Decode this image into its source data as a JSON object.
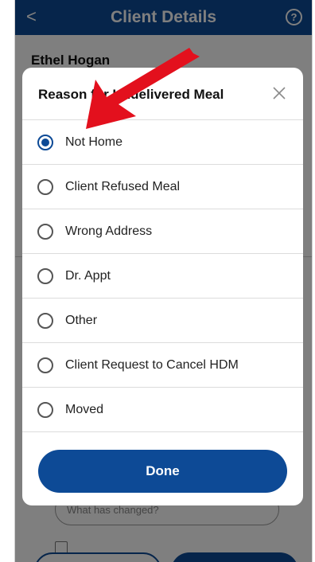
{
  "header": {
    "title": "Client Details",
    "back_glyph": "<",
    "help_glyph": "?"
  },
  "client": {
    "name": "Ethel Hogan"
  },
  "background_form": {
    "changes_placeholder": "What has changed?"
  },
  "modal": {
    "title": "Reason for Undelivered Meal",
    "close_glyph": "×",
    "options": [
      {
        "label": "Not Home",
        "selected": true
      },
      {
        "label": "Client Refused Meal",
        "selected": false
      },
      {
        "label": "Wrong Address",
        "selected": false
      },
      {
        "label": "Dr. Appt",
        "selected": false
      },
      {
        "label": "Other",
        "selected": false
      },
      {
        "label": "Client Request to Cancel HDM",
        "selected": false
      },
      {
        "label": "Moved",
        "selected": false
      }
    ],
    "done_label": "Done"
  },
  "colors": {
    "brand": "#0d4a96",
    "annotation_arrow": "#e3101d"
  },
  "icons": {
    "back": "chevron-left-icon",
    "help": "help-circle-icon",
    "close": "close-icon",
    "annotation": "red-arrow-annotation"
  }
}
